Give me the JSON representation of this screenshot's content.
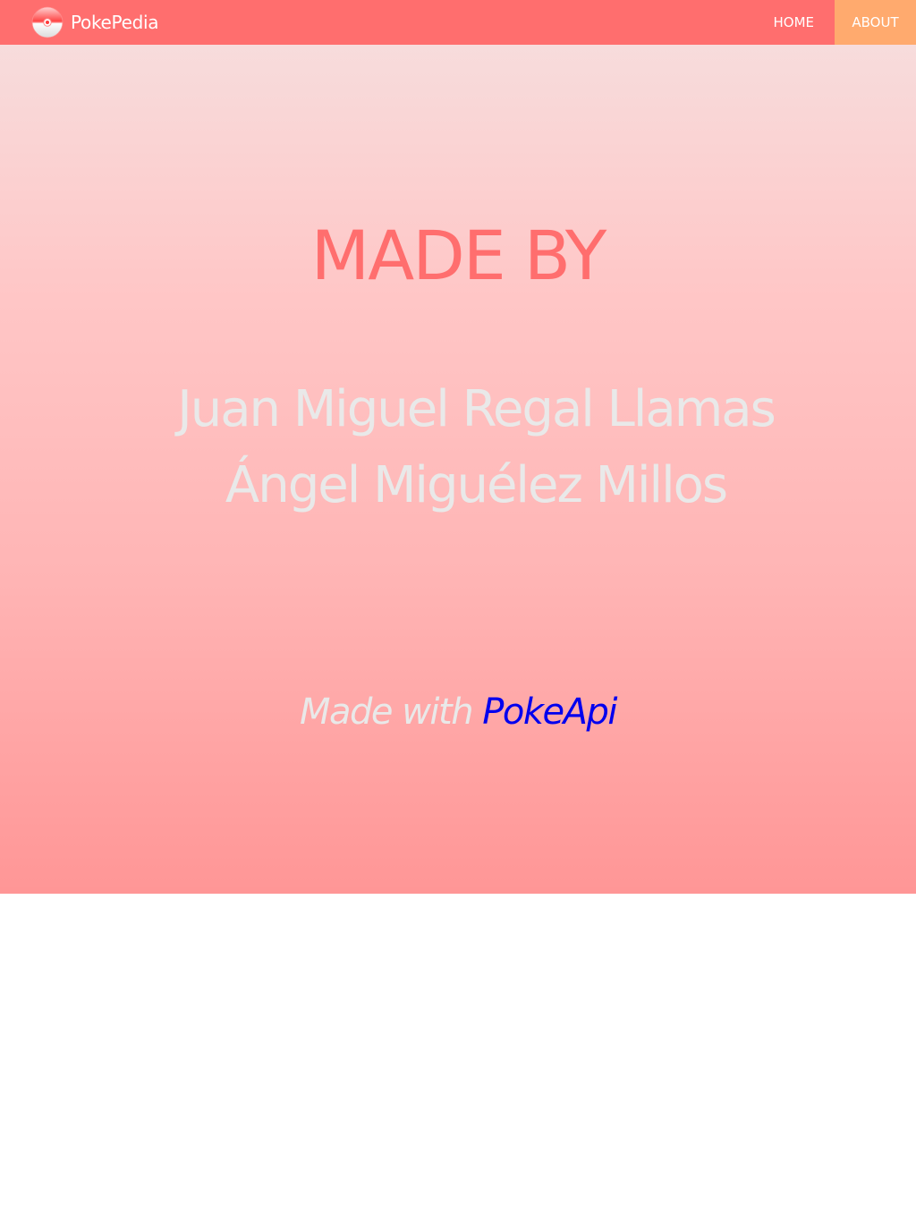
{
  "navbar": {
    "brand_name": "PokePedia",
    "brand_icon": "pokeball-icon",
    "links": [
      {
        "label": "HOME",
        "active": false
      },
      {
        "label": "ABOUT",
        "active": true
      }
    ]
  },
  "hero": {
    "heading": "MADE BY",
    "authors": [
      "Juan Miguel Regal Llamas",
      "Ángel Miguélez Millos"
    ],
    "credit_prefix": "Made with",
    "credit_link": "PokeApi"
  },
  "colors": {
    "navbar_bg": "#ff6e6e",
    "active_tab_bg": "#ffaa6e",
    "heading": "#ff6e6e",
    "author_text": "#e9e9e9",
    "link": "#0000ee"
  }
}
